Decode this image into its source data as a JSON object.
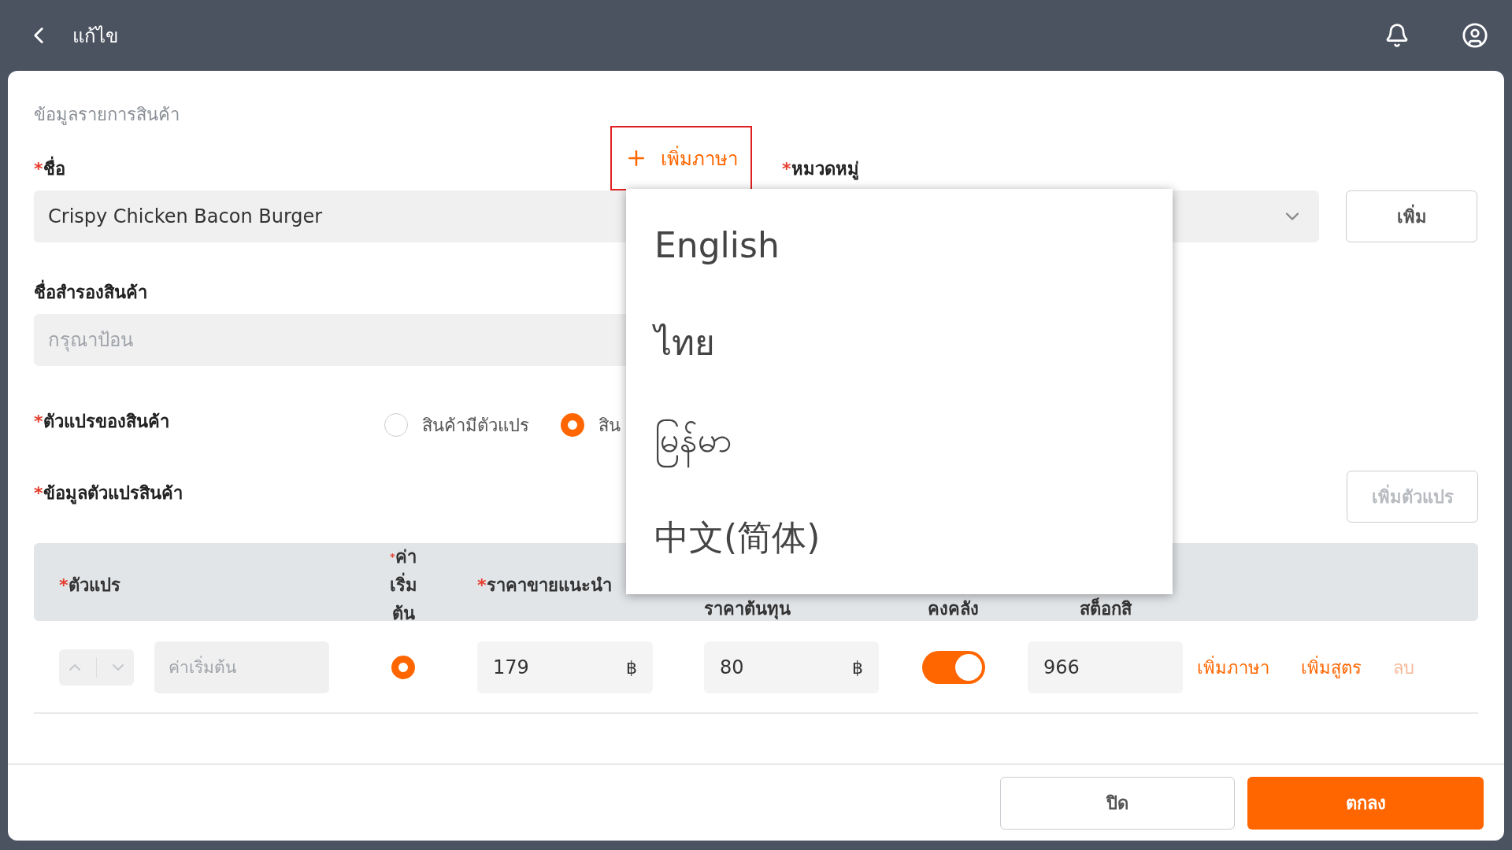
{
  "top_bar": {
    "title": "แก้ไข"
  },
  "section_title": "ข้อมูลรายการสินค้า",
  "name_field": {
    "mark": "*",
    "label": "ชื่อ",
    "value": "Crispy Chicken Bacon Burger",
    "add_language": "เพิ่มภาษา"
  },
  "category_field": {
    "mark": "*",
    "label": "หมวดหมู่",
    "add_button": "เพิ่ม"
  },
  "alt_name_field": {
    "label": "ชื่อสำรองสินค้า",
    "placeholder": "กรุณาป้อน"
  },
  "variant_type": {
    "mark": "*",
    "label": "ตัวแปรของสินค้า",
    "options": [
      {
        "label": "สินค้ามีตัวแปร",
        "selected": false
      },
      {
        "label": "สิน",
        "selected": true
      }
    ]
  },
  "variant_info": {
    "mark": "*",
    "label": "ข้อมูลตัวแปรสินค้า",
    "add_button": {
      "label": "เพิ่มตัวแปร",
      "disabled": true
    }
  },
  "table": {
    "columns": [
      {
        "mark": "*",
        "lines": [
          "ตัวแปร"
        ]
      },
      {
        "mark": "*",
        "lines": [
          "ค่า",
          "เริ่ม",
          "ต้น"
        ]
      },
      {
        "mark": "*",
        "lines": [
          "ราคาขายแนะนำ"
        ]
      },
      {
        "lines": [
          "ราคาต้นทุน"
        ]
      },
      {
        "lines": [
          "คงคลัง"
        ]
      },
      {
        "lines": [
          "สต็อกสิ"
        ]
      }
    ],
    "rows": [
      {
        "variant_placeholder": "ค่าเริ่มต้น",
        "default_selected": true,
        "price": "179",
        "price_currency": "฿",
        "cost": "80",
        "cost_currency": "฿",
        "stock_on": true,
        "stock": "966",
        "actions": [
          {
            "label": "เพิ่มภาษา",
            "disabled": false
          },
          {
            "label": "เพิ่มสูตร",
            "disabled": false
          },
          {
            "label": "ลบ",
            "disabled": true
          }
        ]
      }
    ]
  },
  "footer_buttons": [
    {
      "label": "ปิด",
      "kind": "secondary"
    },
    {
      "label": "ตกลง",
      "kind": "primary"
    }
  ],
  "language_menu": {
    "items": [
      "English",
      "ไทย",
      "မြန်မာ",
      "中文(简体)"
    ]
  }
}
